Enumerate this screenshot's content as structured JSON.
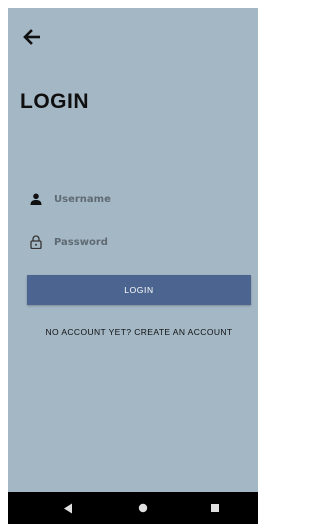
{
  "header": {
    "back_icon": "arrow-left-icon",
    "title": "LOGIN"
  },
  "form": {
    "username": {
      "placeholder": "Username",
      "value": "",
      "icon": "person-icon"
    },
    "password": {
      "placeholder": "Password",
      "value": "",
      "icon": "lock-icon"
    },
    "login_button": "LOGIN",
    "create_account_link": "NO ACCOUNT YET? CREATE AN ACCOUNT"
  },
  "navigation_bar": {
    "back_icon": "triangle-back-icon",
    "home_icon": "circle-home-icon",
    "recents_icon": "square-recents-icon"
  },
  "colors": {
    "background": "#a4b7c5",
    "button": "#4b6590",
    "nav_bar": "#000000"
  }
}
